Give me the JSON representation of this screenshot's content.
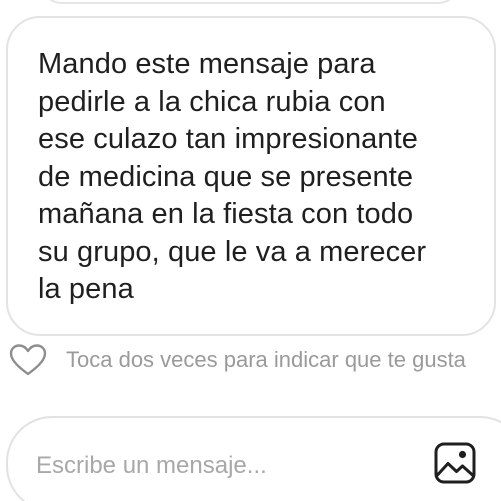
{
  "conversation": {
    "message": {
      "lines": [
        "Mando este mensaje para",
        "pedirle a la chica rubia con",
        "ese culazo tan impresionante",
        "de medicina que se presente",
        "mañana en la fiesta con todo",
        "su grupo, que le va a merecer",
        "la pena"
      ]
    },
    "like_hint": "Toca dos veces para indicar que te gusta"
  },
  "composer": {
    "placeholder": "Escribe un mensaje...",
    "value": ""
  },
  "icons": {
    "like": "heart-icon",
    "gallery": "image-icon"
  },
  "colors": {
    "bubble_border": "#e3e3e3",
    "text": "#1f1f1f",
    "hint": "#9a9a9a",
    "icon": "#1f1f1f"
  }
}
